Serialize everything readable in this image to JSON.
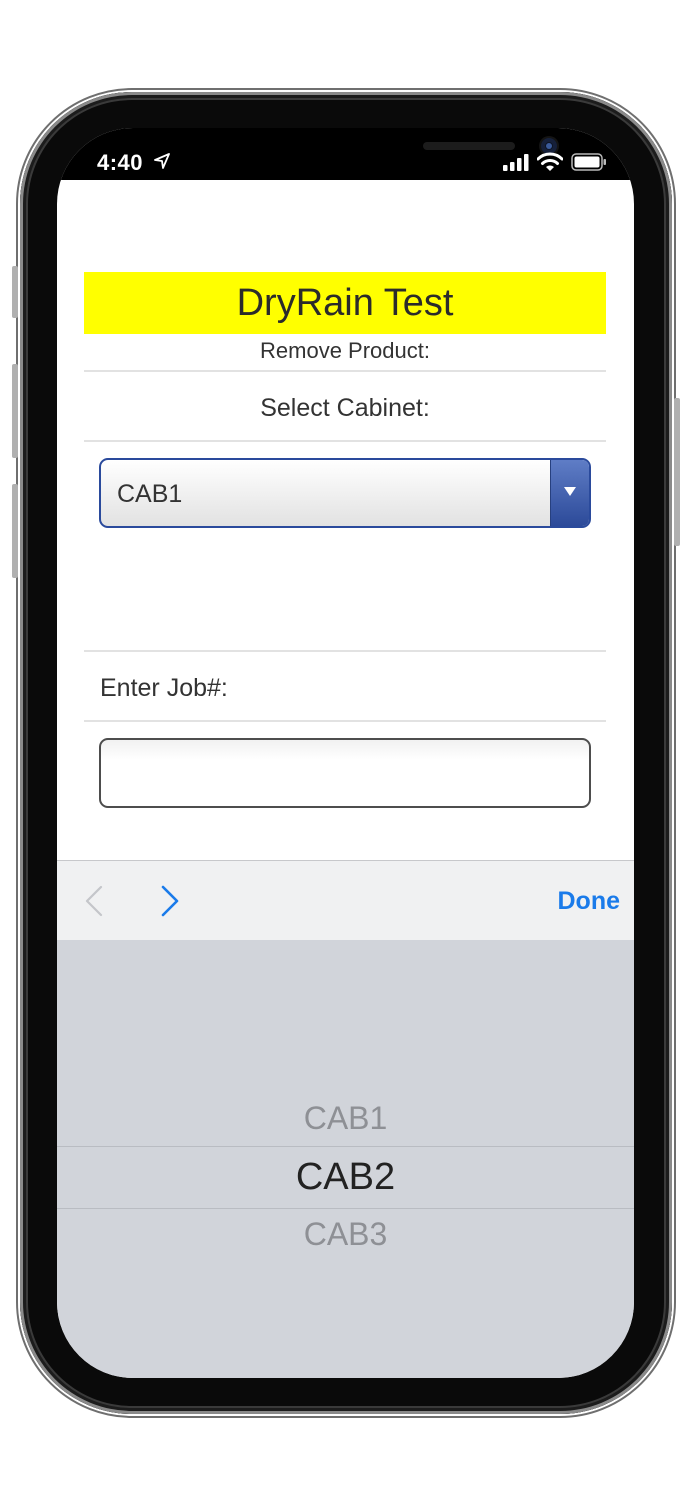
{
  "status_bar": {
    "time": "4:40",
    "icons": [
      "location-arrow-icon",
      "cellular-signal-icon",
      "wifi-icon",
      "battery-icon"
    ]
  },
  "page": {
    "title": "DryRain Test",
    "title_bg_color": "#ffff00",
    "subtitle": "Remove Product:",
    "cabinet_label": "Select Cabinet:",
    "cabinet_select": {
      "selected": "CAB1"
    },
    "job_label": "Enter Job#:",
    "job_input": {
      "value": "",
      "placeholder": ""
    }
  },
  "accessory_bar": {
    "prev_icon": "chevron-left-icon",
    "next_icon": "chevron-right-icon",
    "done_label": "Done",
    "accent_color": "#1a7bea"
  },
  "picker": {
    "options": [
      "CAB1",
      "CAB2",
      "CAB3"
    ],
    "selected": "CAB2"
  }
}
